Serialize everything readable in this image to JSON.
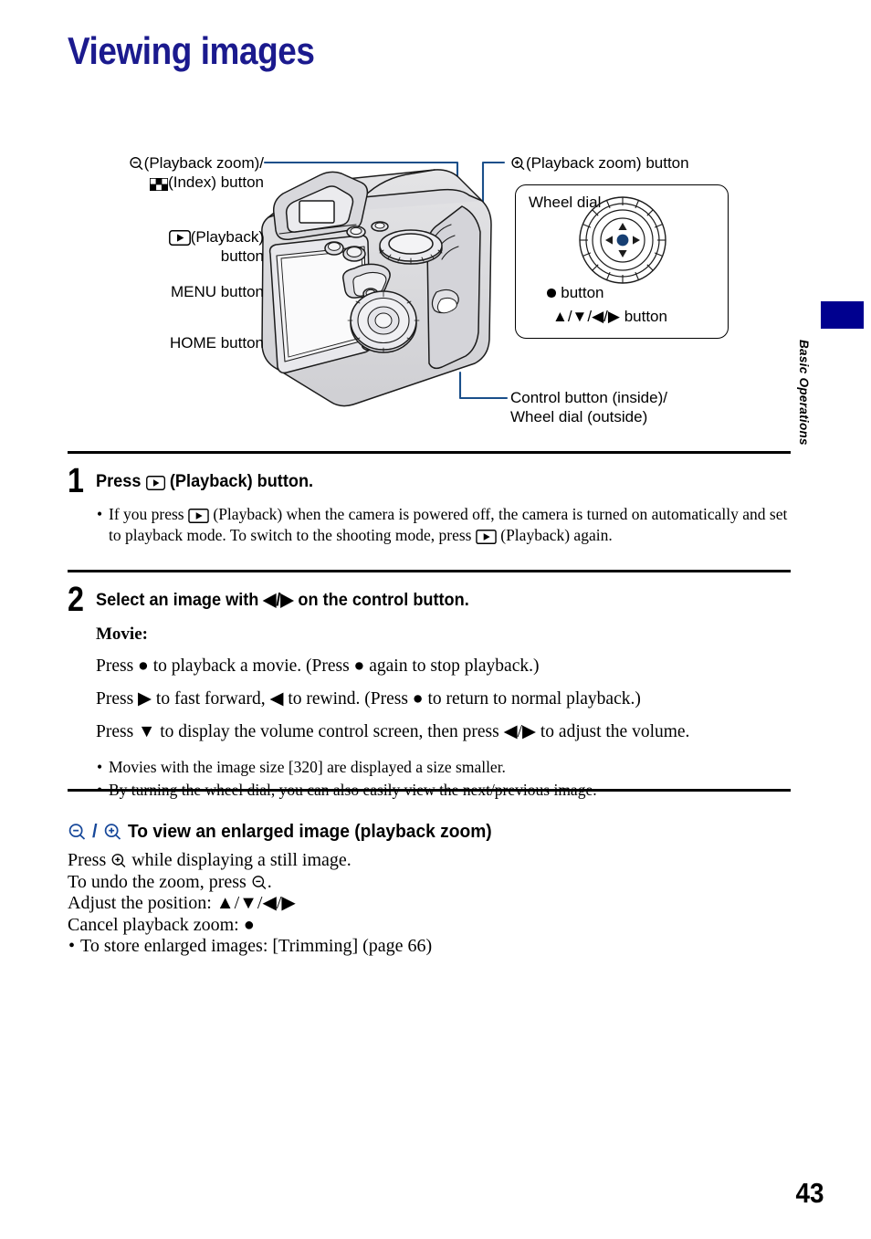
{
  "page": {
    "title": "Viewing images",
    "page_number": "43",
    "side_tab_label": "Basic Operations",
    "accent_color": "#00008f",
    "title_color": "#1b1a8e",
    "leader_color": "#1a4f8a"
  },
  "diagram": {
    "labels": {
      "zoom_out": {
        "icon": "magnifier-minus-icon",
        "line1": "(Playback zoom)/",
        "icon2": "index-checkerboard-icon",
        "line2": "(Index) button"
      },
      "playback": {
        "icon": "playback-triangle-icon",
        "line1": "(Playback)",
        "line2": "button"
      },
      "menu": "MENU button",
      "home": "HOME button",
      "zoom_in": {
        "icon": "magnifier-plus-icon",
        "text": "(Playback zoom) button"
      },
      "control": {
        "line1": "Control button (inside)/",
        "line2": "Wheel dial (outside)"
      }
    },
    "wheel_box": {
      "title": "Wheel dial",
      "button_dot": "button",
      "button_dot_icon": "filled-circle-icon",
      "button_arrows": "button",
      "button_arrows_icon": "up-down-left-right-arrows-icon"
    },
    "camera_illustration": "sony-camera-rear-view-line-art"
  },
  "steps": [
    {
      "number": "1",
      "heading_pre": "Press",
      "heading_icon": "playback-triangle-icon",
      "heading_post": "(Playback) button.",
      "bullets": [
        {
          "pre": "If you press",
          "icon": "playback-triangle-icon",
          "mid": "(Playback) when the camera is powered off, the camera is turned on automatically and set to playback mode. To switch to the shooting mode, press",
          "icon2": "playback-triangle-icon",
          "post": "(Playback) again."
        }
      ]
    },
    {
      "number": "2",
      "heading": "Select an image with ◀/▶ on the control button.",
      "movie_label": "Movie:",
      "movie_lines": [
        "Press ● to playback a movie. (Press ● again to stop playback.)",
        "Press ▶ to fast forward, ◀ to rewind. (Press ● to return to normal playback.)",
        "Press ▼ to display the volume control screen, then press ◀/▶ to adjust the volume."
      ],
      "bullets": [
        "Movies with the image size [320] are displayed a size smaller.",
        "By turning the wheel dial, you can also easily view the next/previous image."
      ]
    }
  ],
  "lower_section": {
    "icon_minus": "magnifier-minus-icon",
    "separator": "/",
    "icon_plus": "magnifier-plus-icon",
    "heading": "To view an enlarged image (playback zoom)",
    "lines": [
      {
        "pre": "Press",
        "icon": "magnifier-plus-icon",
        "post": "while displaying a still image."
      },
      {
        "pre": "To undo the zoom, press",
        "icon": "magnifier-minus-icon",
        "post": "."
      },
      {
        "text": "Adjust the position: ▲/▼/◀/▶"
      },
      {
        "text": "Cancel playback zoom: ●"
      }
    ],
    "bullet": "To store enlarged images: [Trimming] (page 66)"
  }
}
